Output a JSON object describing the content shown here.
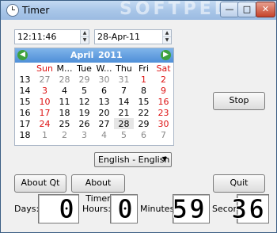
{
  "window": {
    "title": "Timer",
    "watermark": "SOFTPEDIA"
  },
  "time_field": {
    "value": "12:11:46"
  },
  "date_field": {
    "value": "28-Apr-11"
  },
  "calendar": {
    "month": "April",
    "year": "2011",
    "days_of_week": [
      "Sun",
      "M...",
      "Tue",
      "W...",
      "Thu",
      "Fri",
      "Sat"
    ],
    "weeks": [
      {
        "week": "13",
        "days": [
          "27",
          "28",
          "29",
          "30",
          "31",
          "1",
          "2"
        ]
      },
      {
        "week": "14",
        "days": [
          "3",
          "4",
          "5",
          "6",
          "7",
          "8",
          "9"
        ]
      },
      {
        "week": "15",
        "days": [
          "10",
          "11",
          "12",
          "13",
          "14",
          "15",
          "16"
        ]
      },
      {
        "week": "16",
        "days": [
          "17",
          "18",
          "19",
          "20",
          "21",
          "22",
          "23"
        ]
      },
      {
        "week": "17",
        "days": [
          "24",
          "25",
          "26",
          "27",
          "28",
          "29",
          "30"
        ]
      },
      {
        "week": "18",
        "days": [
          "1",
          "2",
          "3",
          "4",
          "5",
          "6",
          "7"
        ]
      }
    ],
    "selected_day": "28"
  },
  "buttons": {
    "stop": "Stop",
    "about_qt": "About Qt",
    "about_timer": "About Timer",
    "quit": "Quit"
  },
  "language": {
    "selected": "English - English"
  },
  "counters": {
    "days_label": "Days:",
    "days_value": "0",
    "hours_label": "Hours:",
    "hours_value": "0",
    "minutes_label": "Minutes:",
    "minutes_value": "59",
    "seconds_label": "Seconds:",
    "seconds_value": "36"
  },
  "colors": {
    "accent": "#4f8fd8",
    "weekend": "#dd1111",
    "titlebar": "#a9c6e8"
  }
}
